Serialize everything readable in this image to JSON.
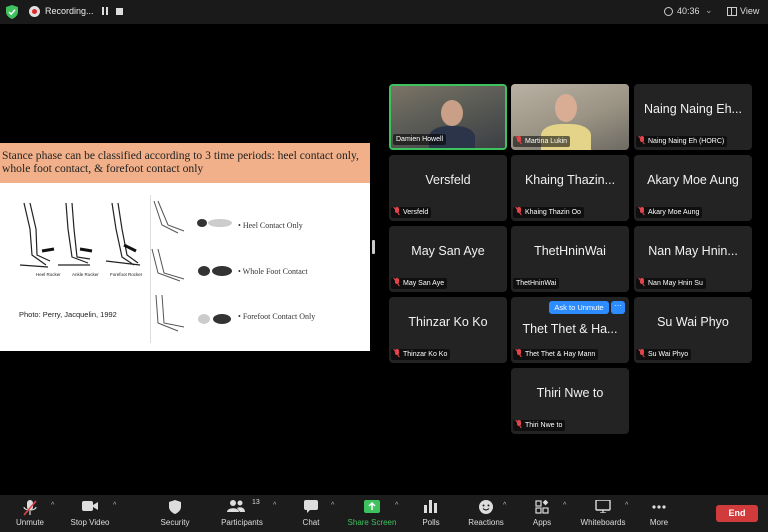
{
  "topbar": {
    "recording_label": "Recording...",
    "timer": "40:36",
    "view_label": "View"
  },
  "slide": {
    "title": "Stance phase can be classified according to 3 time periods: heel contact only, whole foot contact, & forefoot contact only",
    "rocker_captions": [
      "Heel Rocker",
      "Ankle Rocker",
      "Forefoot Rocker"
    ],
    "phases": [
      "Heel Contact Only",
      "Whole Foot Contact",
      "Forefoot Contact Only"
    ],
    "credit": "Photo: Perry, Jacquelin, 1992",
    "title_bg": "#f1b08a"
  },
  "tiles": [
    {
      "display": "",
      "tag": "Damien Howell",
      "video": true,
      "active": true,
      "muted": false
    },
    {
      "display": "",
      "tag": "Martina Lukin",
      "video": true,
      "active": false,
      "muted": true
    },
    {
      "display": "Naing Naing Eh...",
      "tag": "Naing Naing Eh (HORC)",
      "muted": true
    },
    {
      "display": "Versfeld",
      "tag": "Versfeld",
      "muted": true
    },
    {
      "display": "Khaing Thazin...",
      "tag": "Khaing Thazin Oo",
      "muted": true
    },
    {
      "display": "Akary Moe Aung",
      "tag": "Akary Moe Aung",
      "muted": true
    },
    {
      "display": "May San Aye",
      "tag": "May San Aye",
      "muted": true
    },
    {
      "display": "ThetHninWai",
      "tag": "ThetHninWai",
      "muted": false
    },
    {
      "display": "Nan May Hnin...",
      "tag": "Nan May Hnin Su",
      "muted": true
    },
    {
      "display": "Thinzar Ko Ko",
      "tag": "Thinzar Ko Ko",
      "muted": true
    },
    {
      "display": "Thet Thet & Ha...",
      "tag": "Thet Thet & Hay Mann",
      "muted": true
    },
    {
      "display": "Su Wai Phyo",
      "tag": "Su Wai Phyo",
      "muted": true
    },
    {
      "display": "Thiri Nwe to",
      "tag": "Thiri Nwe to",
      "muted": true
    }
  ],
  "hover_controls": {
    "ask_to_unmute": "Ask to Unmute",
    "more": "···"
  },
  "toolbar": {
    "unmute": "Unmute",
    "stop_video": "Stop Video",
    "security": "Security",
    "participants": "Participants",
    "participants_count": "13",
    "chat": "Chat",
    "share_screen": "Share Screen",
    "polls": "Polls",
    "reactions": "Reactions",
    "apps": "Apps",
    "whiteboards": "Whiteboards",
    "more": "More",
    "end": "End"
  },
  "colors": {
    "active_speaker": "#3ec25e",
    "share_green": "#3ec25e",
    "end_red": "#d23b3b",
    "ask_blue": "#2d8cff"
  }
}
